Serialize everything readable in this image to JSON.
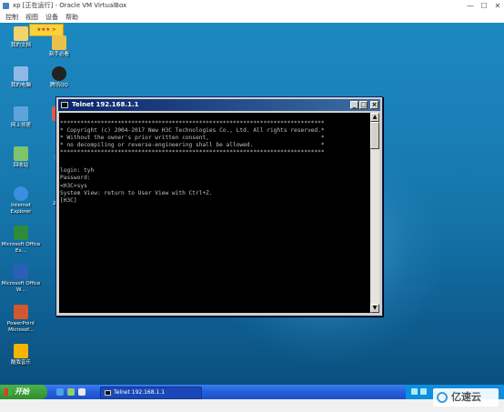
{
  "host": {
    "title": "xp [正在运行] - Oracle VM VirtualBox",
    "menu": [
      "控制",
      "视图",
      "设备",
      "帮助"
    ],
    "window_buttons": [
      "—",
      "☐",
      "✕"
    ]
  },
  "desktop": {
    "banner": "★★★ >",
    "icons": [
      {
        "label": "我的文档"
      },
      {
        "label": "新手必看"
      },
      {
        "label": "我的电脑"
      },
      {
        "label": "腾讯QQ"
      },
      {
        "label": "网上邻居"
      },
      {
        "label": "回收站"
      },
      {
        "label": "Internet Explorer"
      },
      {
        "label": "Microsoft Office Ex..."
      },
      {
        "label": "Microsoft Office W..."
      },
      {
        "label": "PowerPoint Microsof..."
      },
      {
        "label": "酷我音乐"
      }
    ],
    "partial_labels": [
      "网",
      "360",
      "2345"
    ]
  },
  "telnet": {
    "title": "Telnet 192.168.1.1",
    "buttons": [
      "_",
      "□",
      "×"
    ],
    "lines": [
      "******************************************************************************",
      "* Copyright (c) 2004-2017 New H3C Technologies Co., Ltd. All rights reserved.*",
      "* Without the owner's prior written consent,                                 *",
      "* no decompiling or reverse-engineering shall be allowed.                    *",
      "******************************************************************************",
      "",
      "",
      "login: tyh",
      "Password:",
      "<H3C>sys",
      "System View: return to User View with Ctrl+Z.",
      "[H3C]"
    ]
  },
  "taskbar": {
    "start_label": "开始",
    "task_label": "Telnet 192.168.1.1"
  },
  "watermark": "亿速云"
}
